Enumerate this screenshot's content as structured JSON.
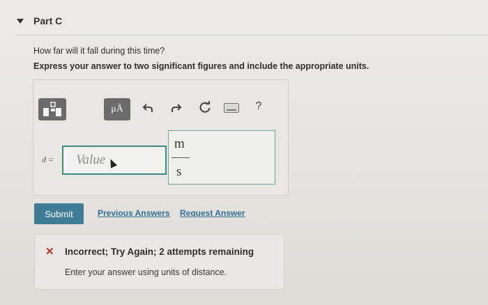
{
  "part": {
    "title": "Part C"
  },
  "question": {
    "prompt": "How far will it fall during this time?",
    "instruction": "Express your answer to two significant figures and include the appropriate units."
  },
  "toolbar": {
    "units_label": "μÅ",
    "help_label": "?"
  },
  "answer": {
    "variable_label": "d =",
    "value_placeholder": "Value",
    "unit_numerator": "m",
    "unit_denominator": "s"
  },
  "actions": {
    "submit_label": "Submit",
    "previous_answers_label": "Previous Answers",
    "request_answer_label": "Request Answer"
  },
  "feedback": {
    "title": "Incorrect; Try Again; 2 attempts remaining",
    "message": "Enter your answer using units of distance.",
    "icon_color": "#c4302a"
  },
  "colors": {
    "accent": "#3f7d97",
    "link": "#2f6f98",
    "input_border": "#3c8a80"
  }
}
